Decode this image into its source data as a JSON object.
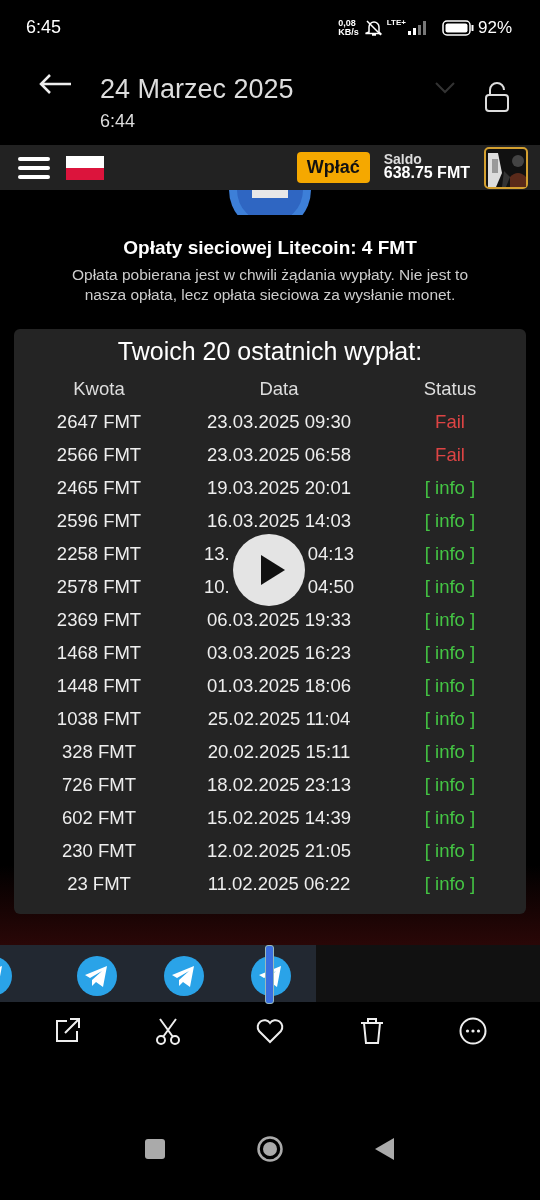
{
  "status_bar": {
    "time": "6:45",
    "speed_value": "0,08",
    "speed_unit": "KB/s",
    "network": "LTE+",
    "battery": "92%"
  },
  "viewer": {
    "title": "24 Marzec 2025",
    "subtitle": "6:44"
  },
  "app_bar": {
    "deposit_button": "Wpłać",
    "balance_label": "Saldo",
    "balance": "638.75 FMT"
  },
  "fee": {
    "heading": "Opłaty sieciowej Litecoin: 4 FMT",
    "note": "Opłata pobierana jest w chwili żądania wypłaty. Nie jest to nasza opłata, lecz opłata sieciowa za wysłanie monet."
  },
  "withdrawals": {
    "title": "Twoich 20 ostatnich wypłat:",
    "columns": [
      "Kwota",
      "Data",
      "Status"
    ],
    "rows": [
      {
        "amount": "2647 FMT",
        "date": "23.03.2025 09:30",
        "status": "Fail",
        "kind": "fail"
      },
      {
        "amount": "2566 FMT",
        "date": "23.03.2025 06:58",
        "status": "Fail",
        "kind": "fail"
      },
      {
        "amount": "2465 FMT",
        "date": "19.03.2025 20:01",
        "status": "[ info ]",
        "kind": "info"
      },
      {
        "amount": "2596 FMT",
        "date": "16.03.2025 14:03",
        "status": "[ info ]",
        "kind": "info"
      },
      {
        "amount": "2258 FMT",
        "date_parts": [
          "13.",
          "04:13"
        ],
        "status": "[ info ]",
        "kind": "info"
      },
      {
        "amount": "2578 FMT",
        "date_parts": [
          "10.",
          "04:50"
        ],
        "status": "[ info ]",
        "kind": "info"
      },
      {
        "amount": "2369 FMT",
        "date": "06.03.2025 19:33",
        "status": "[ info ]",
        "kind": "info"
      },
      {
        "amount": "1468 FMT",
        "date": "03.03.2025 16:23",
        "status": "[ info ]",
        "kind": "info"
      },
      {
        "amount": "1448 FMT",
        "date": "01.03.2025 18:06",
        "status": "[ info ]",
        "kind": "info"
      },
      {
        "amount": "1038 FMT",
        "date": "25.02.2025 11:04",
        "status": "[ info ]",
        "kind": "info"
      },
      {
        "amount": "328 FMT",
        "date": "20.02.2025 15:11",
        "status": "[ info ]",
        "kind": "info"
      },
      {
        "amount": "726 FMT",
        "date": "18.02.2025 23:13",
        "status": "[ info ]",
        "kind": "info"
      },
      {
        "amount": "602 FMT",
        "date": "15.02.2025 14:39",
        "status": "[ info ]",
        "kind": "info"
      },
      {
        "amount": "230 FMT",
        "date": "12.02.2025 21:05",
        "status": "[ info ]",
        "kind": "info"
      },
      {
        "amount": "23 FMT",
        "date": "11.02.2025 06:22",
        "status": "[ info ]",
        "kind": "info"
      }
    ]
  }
}
